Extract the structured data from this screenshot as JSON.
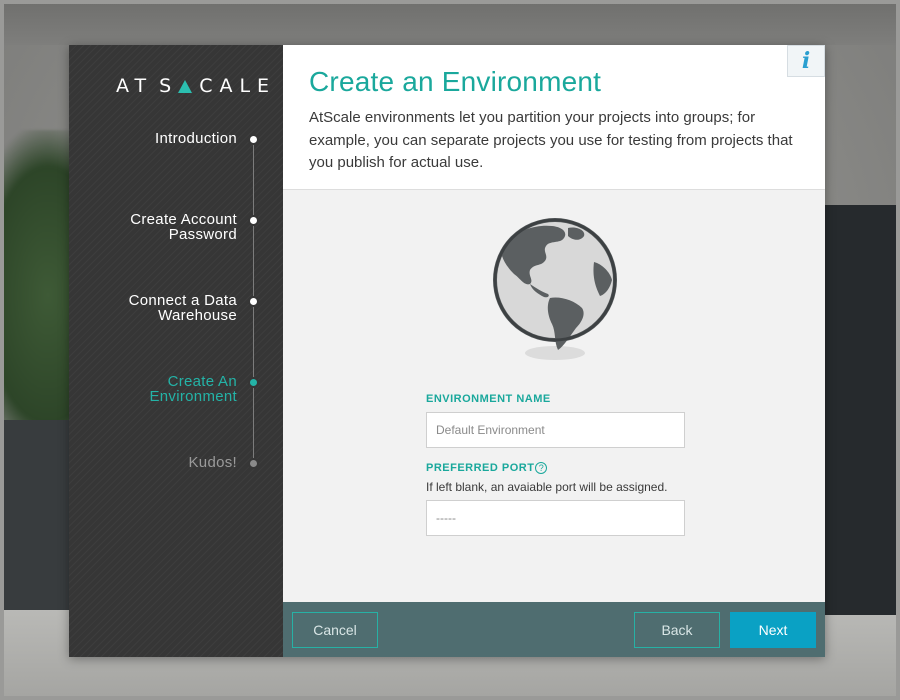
{
  "brand": {
    "name": "ATSCALE",
    "accent": "#24b3a7"
  },
  "steps": [
    {
      "label_line1": "Introduction",
      "label_line2": "",
      "state": "done"
    },
    {
      "label_line1": "Create Account",
      "label_line2": "Password",
      "state": "done"
    },
    {
      "label_line1": "Connect a Data",
      "label_line2": "Warehouse",
      "state": "done"
    },
    {
      "label_line1": "Create An",
      "label_line2": "Environment",
      "state": "active"
    },
    {
      "label_line1": "Kudos!",
      "label_line2": "",
      "state": "future"
    }
  ],
  "header": {
    "title": "Create an Environment",
    "description": "AtScale environments let you partition your projects into groups; for example, you can separate projects you use for testing from projects that you publish for actual use.",
    "info_icon": "info-icon",
    "info_glyph": "i"
  },
  "form": {
    "env_name": {
      "label": "ENVIRONMENT NAME",
      "placeholder": "Default Environment",
      "value": ""
    },
    "port": {
      "label": "PREFERRED PORT",
      "help_glyph": "?",
      "hint": "If left blank, an avaiable port will be assigned.",
      "placeholder": "-----",
      "value": ""
    }
  },
  "footer": {
    "cancel": "Cancel",
    "back": "Back",
    "next": "Next"
  },
  "colors": {
    "teal": "#1aa89c",
    "next_button": "#0aa1c4",
    "footer_bg": "#4f6d70",
    "sidebar_bg": "#363636"
  }
}
